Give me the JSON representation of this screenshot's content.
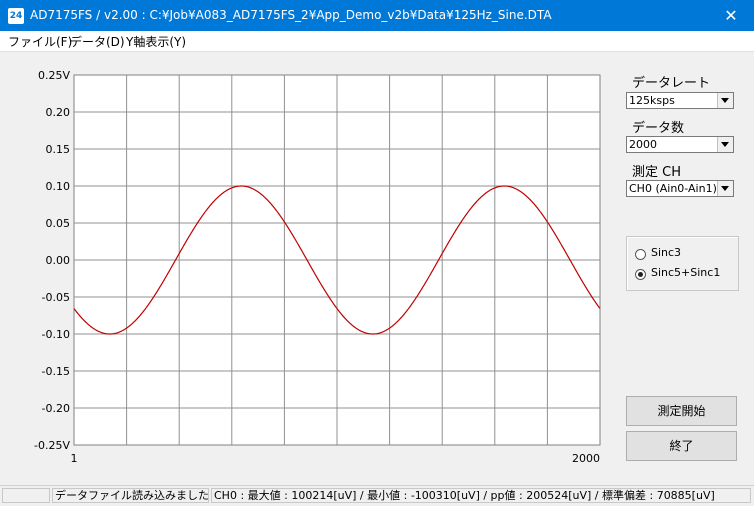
{
  "window": {
    "icon_text": "24",
    "title": "AD7175FS / v2.00 : C:¥Job¥A083_AD7175FS_2¥App_Demo_v2b¥Data¥125Hz_Sine.DTA",
    "close_glyph": "✕"
  },
  "menu": {
    "file": "ファイル(F)",
    "data": "データ(D)",
    "yaxis": "Y軸表示(Y)"
  },
  "chart_data": {
    "type": "line",
    "y_tick_labels": [
      "0.25V",
      "0.20",
      "0.15",
      "0.10",
      "0.05",
      "0.00",
      "-0.05",
      "-0.10",
      "-0.15",
      "-0.20",
      "-0.25V"
    ],
    "x_tick_labels": [
      "1",
      "2000"
    ],
    "xlim": [
      1,
      2000
    ],
    "ylim": [
      -0.25,
      0.25
    ],
    "grid": true,
    "series": [
      {
        "color": "#c00000",
        "waveform": "sine",
        "amplitude": 0.1,
        "cycles": 2,
        "x_first_min": 137,
        "y_min": -0.1
      }
    ]
  },
  "controls": {
    "rate_label": "データレート",
    "rate_value": "125ksps",
    "count_label": "データ数",
    "count_value": "2000",
    "channel_label": "測定 CH",
    "channel_value": "CH0 (Ain0-Ain1)",
    "filter_options": [
      "Sinc3",
      "Sinc5+Sinc1"
    ],
    "filter_selected": "Sinc5+Sinc1",
    "start_button": "測定開始",
    "exit_button": "終了"
  },
  "status": {
    "pane1": "",
    "pane2": "データファイル読み込みました",
    "pane3": "CH0 : 最大値 : 100214[uV] / 最小値 : -100310[uV] / pp値 : 200524[uV] / 標準偏差 : 70885[uV]"
  }
}
